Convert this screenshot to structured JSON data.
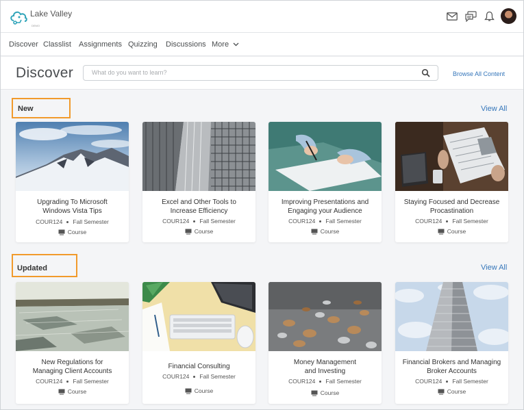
{
  "brand": {
    "name": "Lake Valley",
    "sub": "DEMO"
  },
  "nav": [
    {
      "label": "Discover"
    },
    {
      "label": "Classlist"
    },
    {
      "label": "Assignments"
    },
    {
      "label": "Quizzing"
    },
    {
      "label": "Discussions"
    },
    {
      "label": "More"
    }
  ],
  "discover": {
    "title": "Discover",
    "search_placeholder": "What do you want to learn?",
    "browse_label": "Browse All Content"
  },
  "sections": [
    {
      "heading": "New",
      "view_all": "View All",
      "cards": [
        {
          "title_line1": "Upgrading To Microsoft",
          "title_line2": "Windows Vista Tips",
          "code": "COUR124",
          "semester": "Fall Semester",
          "type": "Course",
          "image": "snowy-mountain"
        },
        {
          "title_line1": "Excel and Other Tools to",
          "title_line2": "Increase Efficiency",
          "code": "COUR124",
          "semester": "Fall Semester",
          "type": "Course",
          "image": "office-building"
        },
        {
          "title_line1": "Improving Presentations and",
          "title_line2": "Engaging your Audience",
          "code": "COUR124",
          "semester": "Fall Semester",
          "type": "Course",
          "image": "writing-hands"
        },
        {
          "title_line1": "Staying Focused and Decrease",
          "title_line2": "Procastination",
          "code": "COUR124",
          "semester": "Fall Semester",
          "type": "Course",
          "image": "newspaper-laptop"
        }
      ]
    },
    {
      "heading": "Updated",
      "view_all": "View All",
      "cards": [
        {
          "title_line1": "New Regulations for",
          "title_line2": "Managing Client Accounts",
          "code": "COUR124",
          "semester": "Fall Semester",
          "type": "Course",
          "image": "frozen-lake"
        },
        {
          "title_line1": "Financial Consulting",
          "title_line2": "",
          "code": "COUR124",
          "semester": "Fall Semester",
          "type": "Course",
          "image": "desk-keyboard"
        },
        {
          "title_line1": "Money Management",
          "title_line2": "and Investing",
          "code": "COUR124",
          "semester": "Fall Semester",
          "type": "Course",
          "image": "coins"
        },
        {
          "title_line1": "Financial Brokers and Managing",
          "title_line2": "Broker Accounts",
          "code": "COUR124",
          "semester": "Fall Semester",
          "type": "Course",
          "image": "skyscraper-clouds"
        }
      ]
    }
  ],
  "colors": {
    "accent": "#3576ba",
    "highlight": "#f19a2b",
    "logo": "#2fa4b9"
  }
}
